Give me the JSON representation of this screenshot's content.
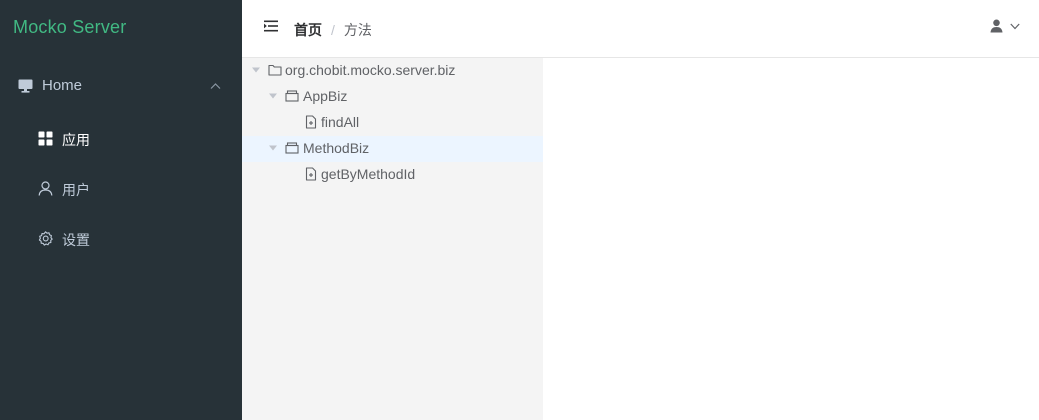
{
  "sidebar": {
    "logo": "Mocko Server",
    "home_label": "Home",
    "items": [
      {
        "label": "应用",
        "icon": "grid-icon",
        "active": true
      },
      {
        "label": "用户",
        "icon": "user-icon",
        "active": false
      },
      {
        "label": "设置",
        "icon": "gear-icon",
        "active": false
      }
    ]
  },
  "header": {
    "breadcrumb": {
      "home": "首页",
      "separator": "/",
      "current": "方法"
    },
    "menu_icon": "menu-fold-icon",
    "user_icon": "user-dropdown-icon"
  },
  "tree": {
    "root": "org.chobit.mocko.server.biz",
    "nodes": [
      {
        "label": "AppBiz",
        "children": [
          "findAll"
        ]
      },
      {
        "label": "MethodBiz",
        "children": [
          "getByMethodId"
        ]
      }
    ]
  },
  "colors": {
    "sidebar_bg": "#273238",
    "logo": "#41b983",
    "tree_bg": "#f4f4f4",
    "tree_highlight": "#ecf5ff"
  }
}
